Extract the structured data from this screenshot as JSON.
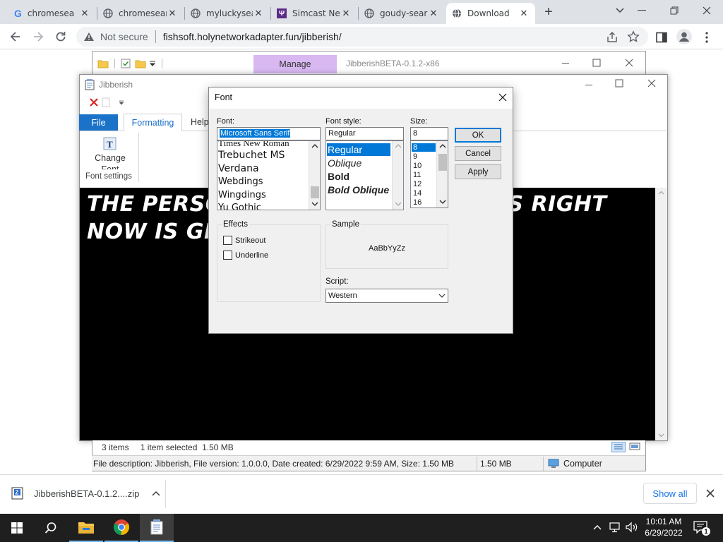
{
  "browser": {
    "tabs": [
      {
        "title": "chromesea",
        "icon": "google-icon"
      },
      {
        "title": "chromesear",
        "icon": "globe-icon"
      },
      {
        "title": "myluckysea",
        "icon": "globe-icon"
      },
      {
        "title": "Simcast Ne",
        "icon": "simcast-icon"
      },
      {
        "title": "goudy-sear",
        "icon": "globe-icon"
      },
      {
        "title": "Download",
        "icon": "globe-icon",
        "active": true
      }
    ],
    "security": "Not secure",
    "url": "fishsoft.holynetworkadapter.fun/jibberish/"
  },
  "explorer": {
    "manage_label": "Manage",
    "window_title": "JibberishBETA-0.1.2-x86",
    "status": {
      "items": "3 items",
      "selected": "1 item selected  1.50 MB",
      "description": "File description: Jibberish, File version: 1.0.0.0, Date created: 6/29/2022 9:59 AM, Size: 1.50 MB",
      "size": "1.50 MB",
      "location": "Computer"
    }
  },
  "jibberish": {
    "title": "Jibberish",
    "tabs": {
      "file": "File",
      "formatting": "Formatting",
      "help": "Help"
    },
    "change_font": "Change Font",
    "group_label": "Font settings",
    "content_text": "THE PERSON WHO IS READING THIS RIGHT NOW IS GENUINE LOVES EDP445"
  },
  "font_dialog": {
    "title": "Font",
    "font_label": "Font:",
    "font_value": "Microsoft Sans Serif",
    "fonts": [
      "Times New Roman",
      "Trebuchet MS",
      "Verdana",
      "Webdings",
      "Wingdings",
      "Yu Gothic"
    ],
    "style_label": "Font style:",
    "style_value": "Regular",
    "styles": [
      "Regular",
      "Oblique",
      "Bold",
      "Bold Oblique"
    ],
    "size_label": "Size:",
    "size_value": "8",
    "sizes": [
      "8",
      "9",
      "10",
      "11",
      "12",
      "14",
      "16"
    ],
    "ok": "OK",
    "cancel": "Cancel",
    "apply": "Apply",
    "effects_label": "Effects",
    "strikeout": "Strikeout",
    "underline": "Underline",
    "sample_label": "Sample",
    "sample_text": "AaBbYyZz",
    "script_label": "Script:",
    "script_value": "Western"
  },
  "downloads": {
    "file": "JibberishBETA-0.1.2....zip",
    "show_all": "Show all"
  },
  "taskbar": {
    "time": "10:01 AM",
    "date": "6/29/2022",
    "notification_count": "1"
  },
  "colors": {
    "selection": "#0078d7",
    "manage": "#d9b8f2",
    "taskbar": "#1f1f1f"
  }
}
